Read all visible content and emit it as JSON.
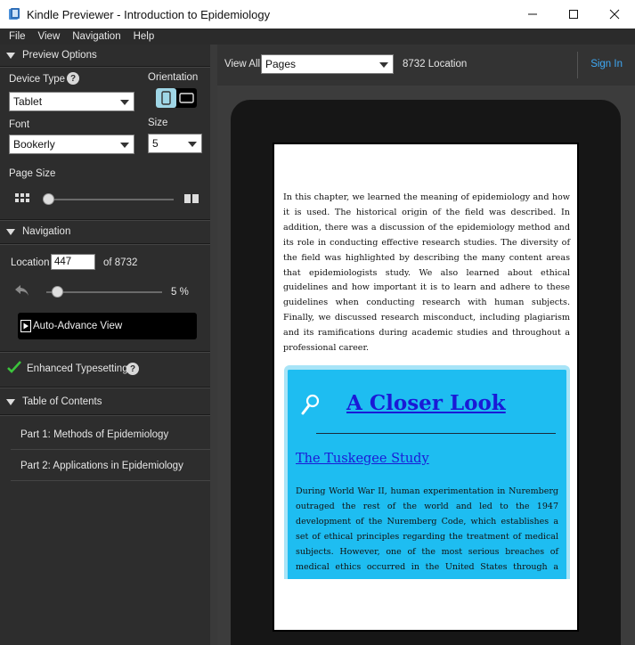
{
  "window": {
    "title": "Kindle Previewer - Introduction to Epidemiology",
    "minimize_icon": "minimize-icon",
    "maximize_icon": "maximize-icon",
    "close_icon": "close-icon"
  },
  "menu": {
    "items": [
      "File",
      "View",
      "Navigation",
      "Help"
    ]
  },
  "sidebar": {
    "preview_options": {
      "header": "Preview Options",
      "device_type_label": "Device Type",
      "device_type_value": "Tablet",
      "orientation_label": "Orientation",
      "font_label": "Font",
      "font_value": "Bookerly",
      "size_label": "Size",
      "size_value": "5",
      "page_size_label": "Page Size"
    },
    "navigation": {
      "header": "Navigation",
      "location_label": "Location",
      "location_value": "447",
      "of_label": "of 8732",
      "progress_percent": "5 %",
      "progress_fraction": 0.05,
      "auto_advance_label": "Auto-Advance View"
    },
    "enhanced_typesetting_label": "Enhanced Typesetting",
    "toc": {
      "header": "Table of Contents",
      "items": [
        "Part 1: Methods of Epidemiology",
        "Part 2: Applications in Epidemiology"
      ]
    }
  },
  "toolbar": {
    "view_all_label": "View All",
    "view_mode_value": "Pages",
    "location_readout": "8732 Location",
    "sign_in_label": "Sign In"
  },
  "page": {
    "body_text": "In this chapter, we learned the meaning of epidemiology and how it is used. The historical origin of the field was described. In addition, there was a discussion of the epidemiology method and its role in conducting effective research studies. The diversity of the field was highlighted by describing the many content areas that epidemiologists study. We also learned about ethical guidelines and how important it is to learn and adhere to these guidelines when conducting research with human subjects. Finally, we discussed research misconduct, including plagiarism and its ramifications during academic studies and throughout a professional career.",
    "closer_look": {
      "title": "A Closer Look",
      "subtitle": "The Tuskegee Study",
      "text": "During World War II, human experimentation in Nuremberg outraged the rest of the world and led to the 1947 development of the Nuremberg Code, which establishes a set of ethical principles regarding the treatment of medical subjects. However, one of the most serious breaches of medical ethics occurred in the United States through a study widely known as the Tus-"
    }
  },
  "colors": {
    "sidebar_bg": "#2d2d2d",
    "accent_link": "#3fa9f5",
    "closer_box_bg": "#1ebdf1",
    "heading_blue": "#1a1ad6",
    "check_green": "#3cc43c"
  }
}
